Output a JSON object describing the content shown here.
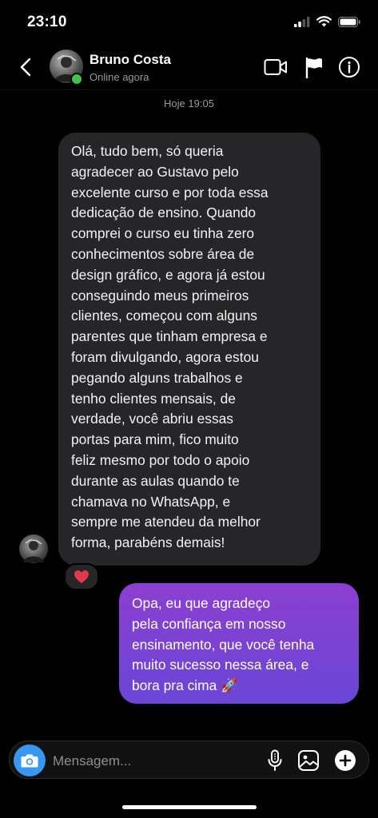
{
  "status_bar": {
    "time": "23:10"
  },
  "header": {
    "contact_name": "Bruno Costa",
    "contact_status": "Online agora",
    "icons": [
      "back-chevron-icon",
      "video-camera-icon",
      "flag-icon",
      "info-icon"
    ]
  },
  "conversation": {
    "date_separator": "Hoje 19:05",
    "messages": [
      {
        "direction": "incoming",
        "lines": [
          "Olá, tudo bem, só queria",
          "agradecer ao Gustavo pelo",
          "excelente curso e por toda essa",
          "dedicação de ensino. Quando",
          "comprei o curso eu tinha zero",
          "conhecimentos sobre área de",
          "design gráfico, e agora já estou",
          "conseguindo meus primeiros",
          "clientes, começou com alguns",
          "parentes que tinham empresa e",
          "foram divulgando, agora estou",
          "pegando alguns trabalhos e",
          "tenho clientes mensais, de",
          "verdade, você abriu essas",
          "portas para mim, fico muito",
          "feliz mesmo por todo o apoio",
          "durante as aulas quando te",
          "chamava no WhatsApp, e",
          "sempre me atendeu da melhor",
          "forma, parabéns demais!"
        ],
        "reaction": "❤️"
      },
      {
        "direction": "outgoing",
        "lines": [
          "Opa, eu que agradeço",
          "pela confiança em nosso",
          "ensinamento, que você tenha",
          "muito sucesso nessa área, e",
          "bora pra cima 🚀"
        ]
      }
    ]
  },
  "composer": {
    "placeholder": "Mensagem...",
    "icons": [
      "camera-icon",
      "microphone-icon",
      "gallery-icon",
      "plus-icon"
    ]
  },
  "colors": {
    "incoming_bubble": "#262628",
    "outgoing_gradient_start": "#8c3fd0",
    "outgoing_gradient_end": "#6a46d6",
    "online_dot": "#3ec44b",
    "camera_button": "#3897f0",
    "heart": "#e0394a"
  }
}
